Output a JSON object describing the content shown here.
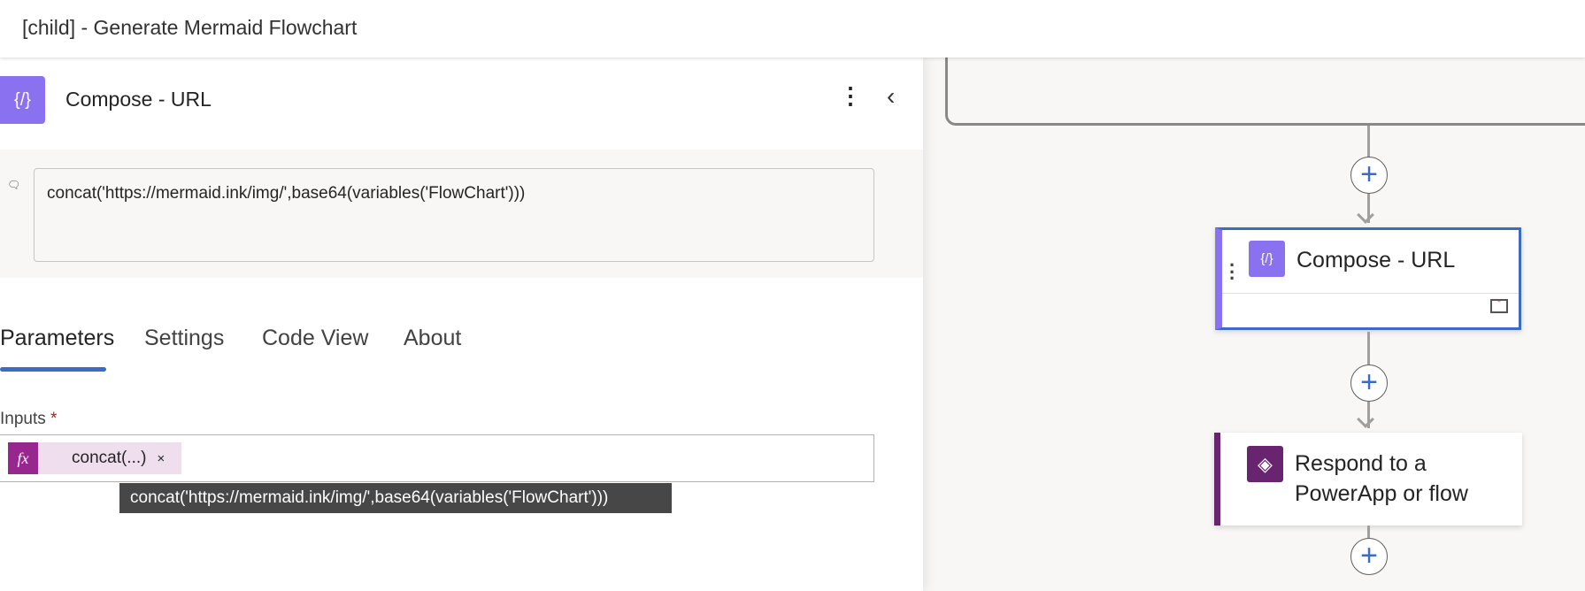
{
  "window": {
    "title": "[child] - Generate Mermaid Flowchart"
  },
  "panel": {
    "title": "Compose - URL",
    "note": "concat('https://mermaid.ink/img/',base64(variables('FlowChart')))",
    "tabs": [
      {
        "label": "Parameters",
        "active": true
      },
      {
        "label": "Settings"
      },
      {
        "label": "Code View"
      },
      {
        "label": "About"
      }
    ],
    "inputs_label": "Inputs",
    "required_mark": "*",
    "token": {
      "icon": "fx",
      "label": "concat(...)",
      "remove": "×"
    },
    "tooltip": "concat('https://mermaid.ink/img/',base64(variables('FlowChart')))"
  },
  "canvas": {
    "cards": [
      {
        "title": "Compose - URL",
        "selected": true
      },
      {
        "title_line1": "Respond to a",
        "title_line2": "PowerApp or flow"
      }
    ]
  },
  "colors": {
    "accent": "#3b6bc6",
    "compose": "#8a71f0",
    "powerapps": "#68246f",
    "fx": "#98268f"
  }
}
